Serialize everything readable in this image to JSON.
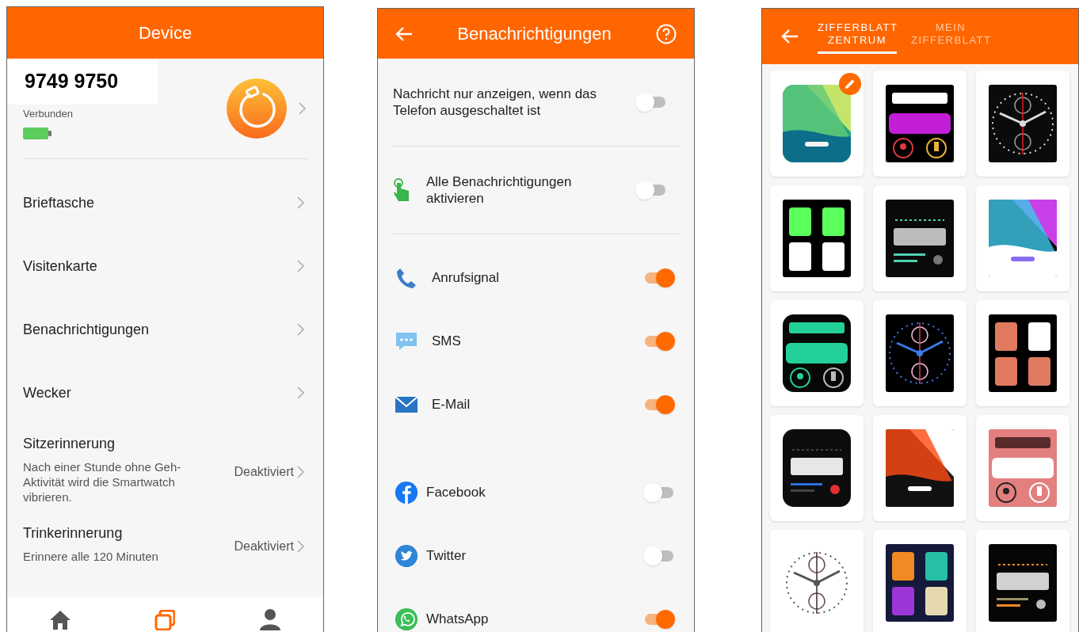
{
  "device_screen": {
    "title": "Device",
    "device": {
      "name": "9749 9750",
      "status": "Verbunden"
    },
    "menu": [
      {
        "label": "Brieftasche"
      },
      {
        "label": "Visitenkarte"
      },
      {
        "label": "Benachrichtigungen"
      },
      {
        "label": "Wecker"
      }
    ],
    "reminders": [
      {
        "title": "Sitzerinnerung",
        "description": "Nach einer Stunde ohne Geh-Aktivität wird die Smartwatch vibrieren.",
        "value": "Deaktiviert"
      },
      {
        "title": "Trinkerinnerung",
        "description": "Erinnere alle 120 Minuten",
        "value": "Deaktiviert"
      }
    ],
    "bottom_nav": [
      {
        "kind": "home",
        "selected": false
      },
      {
        "kind": "devices",
        "selected": true
      },
      {
        "kind": "profile",
        "selected": false
      }
    ]
  },
  "notifications_screen": {
    "title": "Benachrichtigungen",
    "options": [
      {
        "kind": "plain",
        "label": "Nachricht nur anzeigen, wenn das Telefon ausgeschaltet ist",
        "on": false
      },
      {
        "kind": "hand",
        "label": "Alle Benachrichtigungen aktivieren",
        "on": false
      }
    ],
    "apps": [
      {
        "kind": "phone",
        "label": "Anrufsignal",
        "on": true
      },
      {
        "kind": "sms",
        "label": "SMS",
        "on": true
      },
      {
        "kind": "mail",
        "label": "E-Mail",
        "on": true
      },
      {
        "kind": "facebook",
        "label": "Facebook",
        "on": false
      },
      {
        "kind": "twitter",
        "label": "Twitter",
        "on": false
      },
      {
        "kind": "whatsapp",
        "label": "WhatsApp",
        "on": true
      }
    ]
  },
  "watchface_screen": {
    "tabs": [
      {
        "label": "ZIFFERBLATT ZENTRUM",
        "selected": true
      },
      {
        "label": "MEIN ZIFFERBLATT",
        "selected": false
      }
    ],
    "faces": [
      {
        "kind": "picture",
        "edit_badge": true
      },
      {
        "kind": "picture",
        "edit_badge": false
      },
      {
        "kind": "picture",
        "edit_badge": false
      },
      {
        "kind": "picture",
        "edit_badge": false
      },
      {
        "kind": "picture",
        "edit_badge": false
      },
      {
        "kind": "picture",
        "edit_badge": false
      },
      {
        "kind": "picture",
        "edit_badge": false
      },
      {
        "kind": "picture",
        "edit_badge": false
      },
      {
        "kind": "picture",
        "edit_badge": false
      },
      {
        "kind": "picture",
        "edit_badge": false
      },
      {
        "kind": "picture",
        "edit_badge": false
      },
      {
        "kind": "picture",
        "edit_badge": false
      },
      {
        "kind": "picture",
        "edit_badge": false
      },
      {
        "kind": "picture",
        "edit_badge": false
      },
      {
        "kind": "picture",
        "edit_badge": false
      }
    ]
  }
}
